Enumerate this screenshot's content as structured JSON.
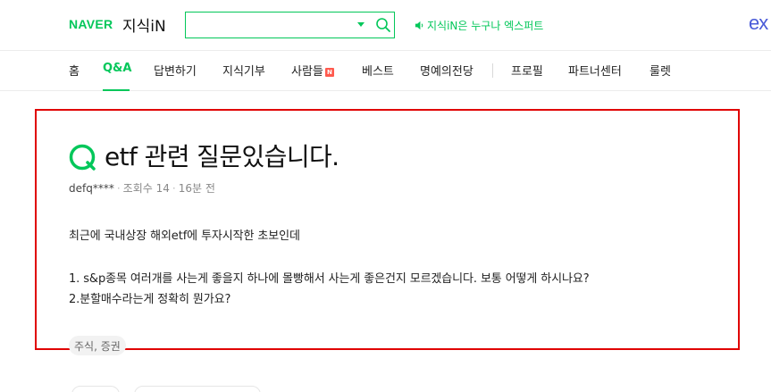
{
  "header": {
    "naver_logo": "NAVER",
    "service_name": "지식iN",
    "search": {
      "value": "",
      "placeholder": ""
    },
    "notice": "지식iN은 누구나 엑스퍼트",
    "expert_logo": "ex"
  },
  "nav": {
    "items": [
      {
        "label": "홈"
      },
      {
        "label": "Q&A"
      },
      {
        "label": "답변하기"
      },
      {
        "label": "지식기부"
      },
      {
        "label": "사람들"
      },
      {
        "label": "베스트"
      },
      {
        "label": "명예의전당"
      },
      {
        "label": "프로필"
      },
      {
        "label": "파트너센터"
      },
      {
        "label": "룰렛"
      }
    ],
    "active": "Q&A",
    "new_badge": "N"
  },
  "question": {
    "title": "etf 관련 질문있습니다.",
    "author": "defq****",
    "views": "조회수 14",
    "time": "16분 전",
    "body": [
      "최근에 국내상장 해외etf에 투자시작한 초보인데",
      "1. s&p종목 여러개를 사는게 좋을지 하나에 몰빵해서 사는게 좋은건지 모르겠습니다. 보통 어떻게 하시나요?",
      "2.분할매수라는게 정확히 뭔가요?"
    ],
    "tag": "주식, 증권"
  },
  "colors": {
    "brand_green": "#03c75a",
    "highlight_red": "#e00000",
    "expert_blue": "#4a5bd8"
  }
}
